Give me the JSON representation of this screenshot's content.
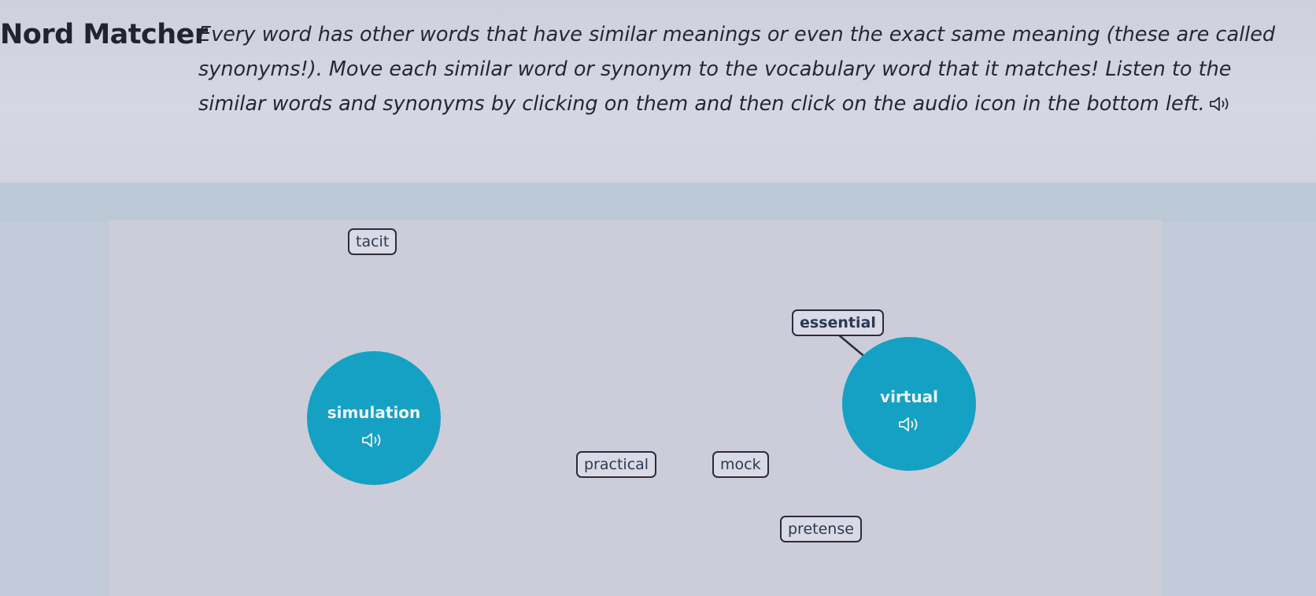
{
  "header": {
    "title": "Nord Matcher",
    "instructions": "Every word has other words that have similar meanings or even the exact same meaning (these are called synonyms!). Move each similar word or synonym to the vocabulary word that it matches! Listen to the similar words and synonyms by clicking on them and then click on the audio icon in the bottom left.",
    "instructions_icon": "speaker-icon"
  },
  "targets": [
    {
      "word": "simulation",
      "icon": "speaker-icon"
    },
    {
      "word": "virtual",
      "icon": "speaker-icon"
    }
  ],
  "chips": [
    {
      "word": "tacit"
    },
    {
      "word": "essential"
    },
    {
      "word": "practical"
    },
    {
      "word": "mock"
    },
    {
      "word": "pretense"
    }
  ],
  "colors": {
    "target_circle": "#14a1c4",
    "chip_border": "#2c2c3c",
    "chip_text": "#2a3a55",
    "band": "#c3cad9",
    "panel": "#cccdd8"
  }
}
